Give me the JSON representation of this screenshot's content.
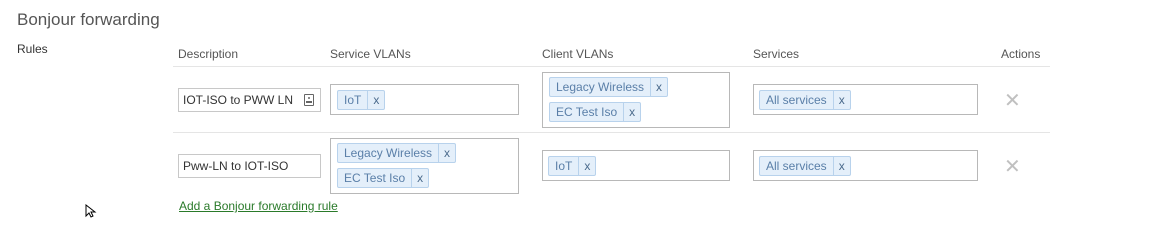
{
  "section": {
    "title": "Bonjour forwarding",
    "rules_label": "Rules"
  },
  "table": {
    "headers": {
      "description": "Description",
      "service_vlans": "Service VLANs",
      "client_vlans": "Client VLANs",
      "services": "Services",
      "actions": "Actions"
    },
    "rows": [
      {
        "description": "IOT-ISO to PWW LN",
        "service_vlans": [
          "IoT"
        ],
        "client_vlans": [
          "Legacy Wireless",
          "EC Test Iso"
        ],
        "services": [
          "All services"
        ]
      },
      {
        "description": "Pww-LN to IOT-ISO",
        "service_vlans": [
          "Legacy Wireless",
          "EC Test Iso"
        ],
        "client_vlans": [
          "IoT"
        ],
        "services": [
          "All services"
        ]
      }
    ]
  },
  "remove_tag_glyph": "x",
  "delete_glyph": "✕",
  "add_rule_link": "Add a Bonjour forwarding rule",
  "icons": {
    "contact": "contact-card-icon",
    "delete": "delete-x-icon",
    "cursor": "mouse-cursor-icon"
  }
}
